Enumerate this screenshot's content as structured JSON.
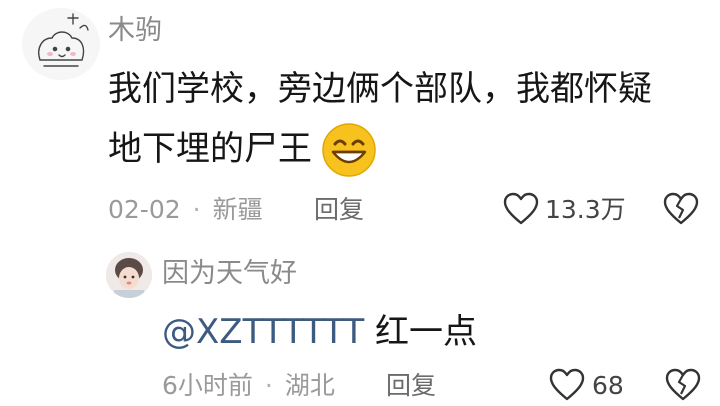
{
  "comment": {
    "username": "木驹",
    "text_line1": "我们学校，旁边俩个部队，我都怀疑",
    "text_line2": "地下埋的尸王",
    "emoji": "grinning-face-icon",
    "date": "02-02",
    "location": "新疆",
    "reply_label": "回复",
    "like_count": "13.3万"
  },
  "reply": {
    "username": "因为天气好",
    "mention": "@XZTTTTTT",
    "text": "红一点",
    "time": "6小时前",
    "location": "湖北",
    "reply_label": "回复",
    "like_count": "68"
  },
  "colors": {
    "mention": "#3d5a80",
    "meta": "#9a9a9a",
    "emoji_face": "#f7c21e"
  }
}
